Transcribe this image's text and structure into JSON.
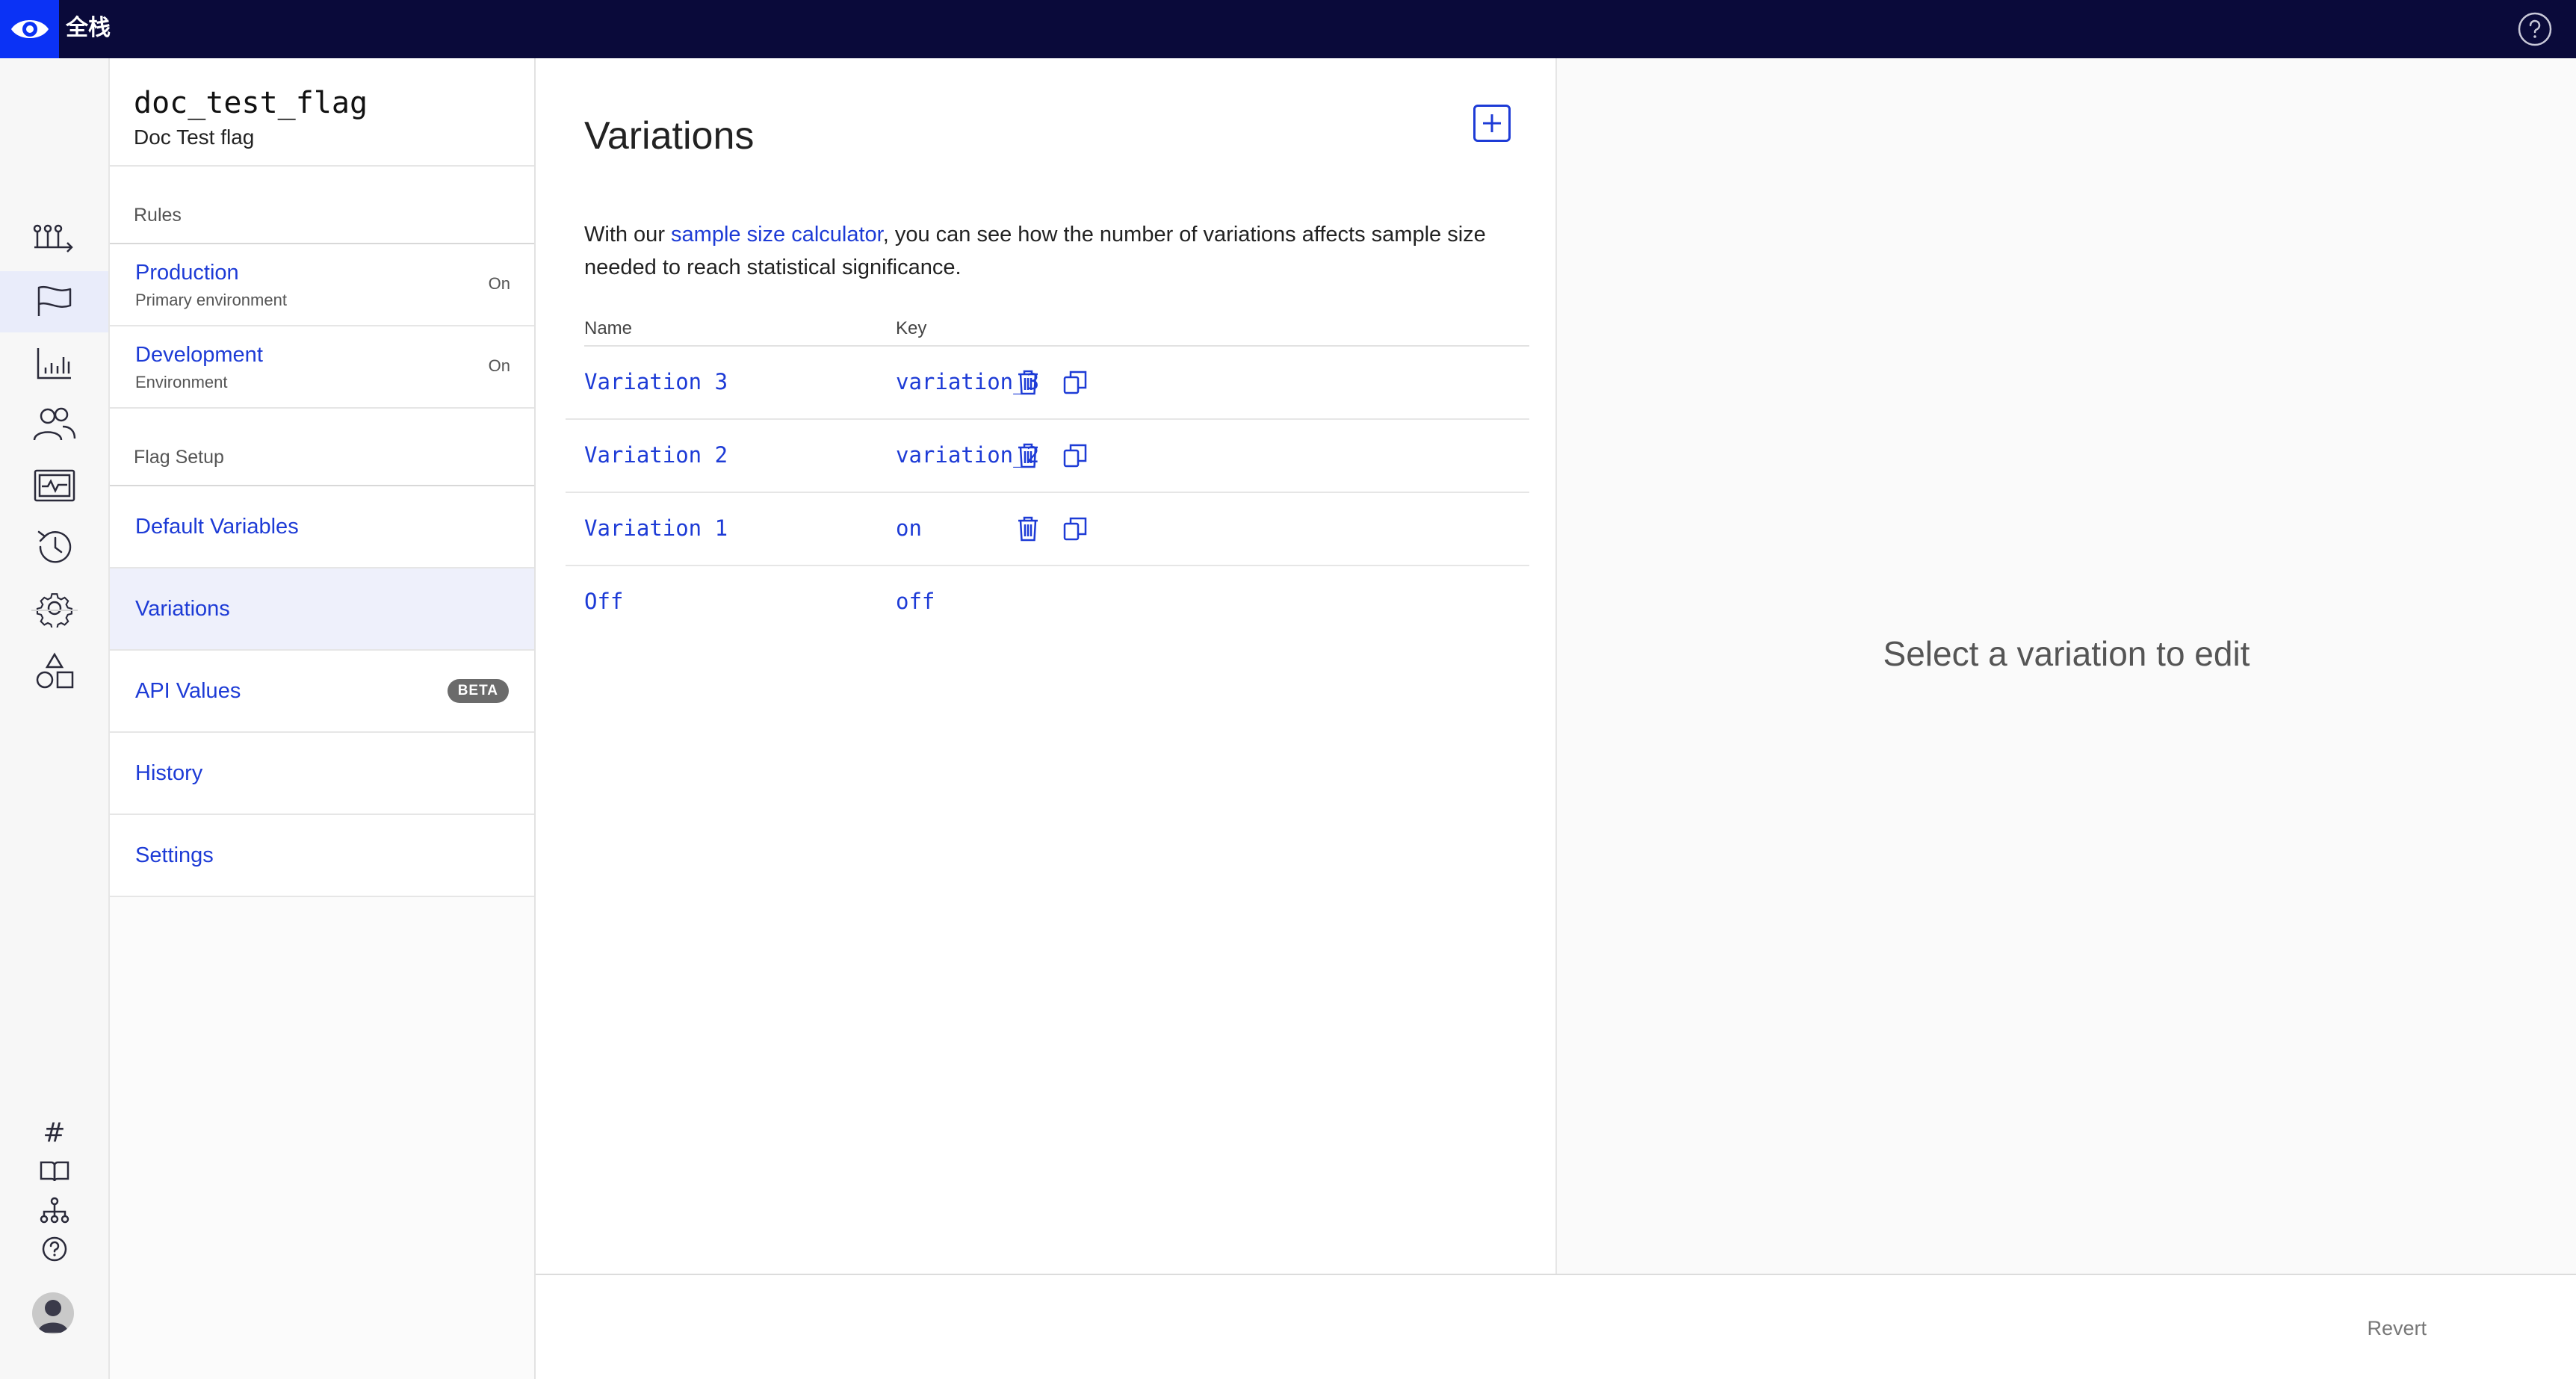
{
  "app": {
    "brand_name": "全栈"
  },
  "flag": {
    "key": "doc_test_flag",
    "name": "Doc Test flag"
  },
  "nav": {
    "rules_heading": "Rules",
    "environments": [
      {
        "name": "Production",
        "type": "Primary environment",
        "state": "On"
      },
      {
        "name": "Development",
        "type": "Environment",
        "state": "On"
      }
    ],
    "setup_heading": "Flag Setup",
    "links": {
      "default_variables": "Default Variables",
      "variations": "Variations",
      "api_values": "API Values",
      "api_values_badge": "BETA",
      "history": "History",
      "settings": "Settings"
    }
  },
  "main": {
    "title": "Variations",
    "intro_prefix": "With our ",
    "intro_link": "sample size calculator",
    "intro_suffix": ", you can see how the number of variations affects sample size needed to reach statistical significance.",
    "columns": {
      "name": "Name",
      "key": "Key"
    },
    "rows": [
      {
        "name": "Variation 3",
        "key": "variation_3"
      },
      {
        "name": "Variation 2",
        "key": "variation_2"
      },
      {
        "name": "Variation 1",
        "key": "on"
      },
      {
        "name": "Off",
        "key": "off"
      }
    ]
  },
  "detail": {
    "empty_message": "Select a variation to edit"
  },
  "footer": {
    "revert_label": "Revert"
  },
  "colors": {
    "accent": "#1d3bd6",
    "topbar": "#0a0a3a",
    "brand": "#0b32f5"
  }
}
